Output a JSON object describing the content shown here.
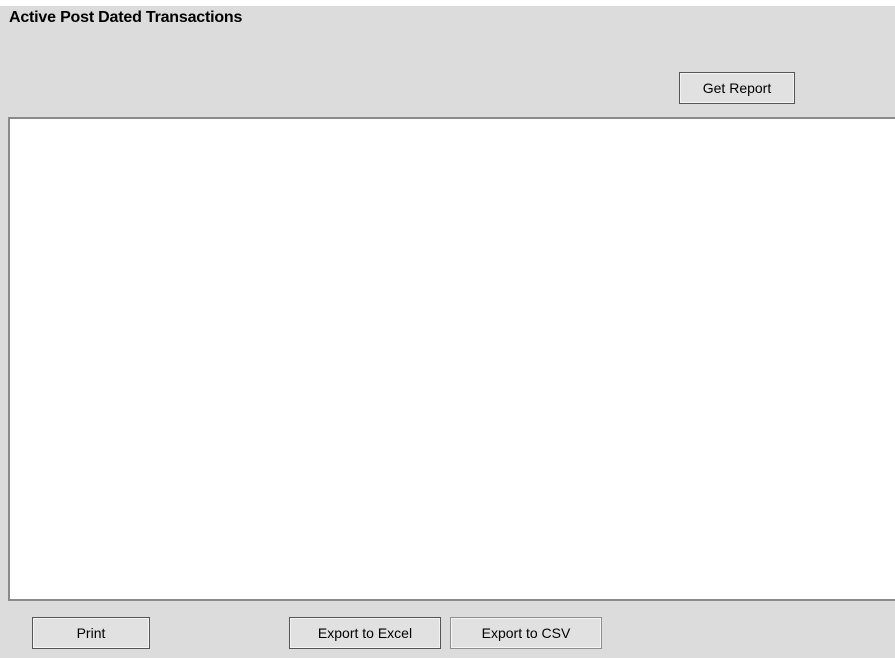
{
  "title": "Active Post Dated Transactions",
  "buttons": {
    "get_report": "Get Report",
    "print": "Print",
    "export_excel": "Export to Excel",
    "export_csv": "Export to CSV"
  },
  "report": {
    "content": ""
  },
  "colors": {
    "panel_background": "#dcdcdc",
    "report_background": "#ffffff",
    "button_background": "#e1e1e1",
    "button_border": "#555555"
  }
}
